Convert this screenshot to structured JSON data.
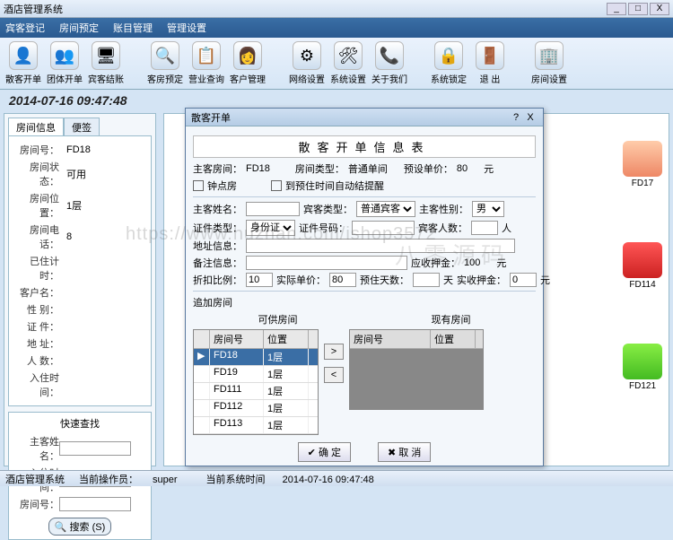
{
  "window": {
    "title": "酒店管理系统",
    "min": "_",
    "max": "□",
    "close": "X"
  },
  "menu": [
    "宾客登记",
    "房间预定",
    "账目管理",
    "管理设置"
  ],
  "toolbar": [
    {
      "icon": "👤",
      "label": "散客开单"
    },
    {
      "icon": "👥",
      "label": "团体开单"
    },
    {
      "icon": "🖥",
      "label": "宾客结账"
    },
    {
      "icon": "🔍",
      "label": "客房预定"
    },
    {
      "icon": "📋",
      "label": "营业查询"
    },
    {
      "icon": "👩",
      "label": "客户管理"
    },
    {
      "icon": "⚙",
      "label": "网络设置"
    },
    {
      "icon": "🛠",
      "label": "系统设置"
    },
    {
      "icon": "📞",
      "label": "关于我们"
    },
    {
      "icon": "🔒",
      "label": "系统锁定"
    },
    {
      "icon": "🚪",
      "label": "退 出"
    },
    {
      "icon": "🏢",
      "label": "房间设置"
    }
  ],
  "datetime": "2014-07-16 09:47:48",
  "left": {
    "tabs": [
      "房间信息",
      "便签"
    ],
    "info": {
      "room_no_k": "房间号：",
      "room_no_v": "FD18",
      "status_k": "房间状态：",
      "status_v": "可用",
      "loc_k": "房间位置：",
      "loc_v": "1层",
      "phone_k": "房间电话：",
      "phone_v": "8",
      "stay_k": "已住计时：",
      "stay_v": "",
      "guest_k": "客户名：",
      "guest_v": "",
      "sex_k": "性 别：",
      "sex_v": "",
      "id_k": "证 件：",
      "id_v": "",
      "addr_k": "地 址：",
      "addr_v": "",
      "count_k": "人 数：",
      "count_v": "",
      "checkin_k": "入住时间：",
      "checkin_v": ""
    },
    "search": {
      "title": "快速查找",
      "name_k": "主客姓名：",
      "in_k": "入住时间：",
      "room_k": "房间号：",
      "btn": "搜索 (S)"
    }
  },
  "rooms": [
    {
      "id": "FD17",
      "cls": "peach"
    },
    {
      "id": "FD114",
      "cls": "red"
    },
    {
      "id": "FD121",
      "cls": "green"
    }
  ],
  "dialog": {
    "title": "散客开单",
    "help": "?",
    "close": "X",
    "heading": "散客开单信息表",
    "main_room_k": "主客房间：",
    "main_room_v": "FD18",
    "room_type_k": "房间类型：",
    "room_type_v": "普通单间",
    "preset_price_k": "预设单价：",
    "preset_price_v": "80",
    "yuan": "元",
    "clock_room": "钟点房",
    "auto_remind": "到预住时间自动结提醒",
    "guest_name_k": "主客姓名：",
    "guest_type_k": "宾客类型：",
    "guest_type_v": "普通宾客",
    "sex_k": "主客性别：",
    "sex_v": "男",
    "id_type_k": "证件类型：",
    "id_type_v": "身份证",
    "id_no_k": "证件号码：",
    "people_k": "宾客人数：",
    "people_unit": "人",
    "addr_k": "地址信息：",
    "remark_k": "备注信息：",
    "deposit_k": "应收押金：",
    "deposit_v": "100",
    "discount_k": "折扣比例：",
    "discount_v": "10",
    "actual_k": "实际单价：",
    "actual_v": "80",
    "days_k": "预住天数：",
    "days_unit": "天",
    "paid_k": "实收押金：",
    "paid_v": "0",
    "add_room": "追加房间",
    "avail": "可供房间",
    "current": "现有房间",
    "col_room": "房间号",
    "col_loc": "位置",
    "avail_rows": [
      {
        "room": "FD18",
        "loc": "1层",
        "sel": true
      },
      {
        "room": "FD19",
        "loc": "1层"
      },
      {
        "room": "FD111",
        "loc": "1层"
      },
      {
        "room": "FD112",
        "loc": "1层"
      },
      {
        "room": "FD113",
        "loc": "1层"
      }
    ],
    "btn_right": ">",
    "btn_left": "<",
    "ok": "确 定",
    "cancel": "取 消"
  },
  "status": {
    "app": "酒店管理系统",
    "user_k": "当前操作员：",
    "user_v": "super",
    "time_k": "当前系统时间",
    "time_v": "2014-07-16 09:47:48"
  },
  "watermark": "https://www.huzhan.com/ishop3572",
  "watermark2": "八零源码"
}
